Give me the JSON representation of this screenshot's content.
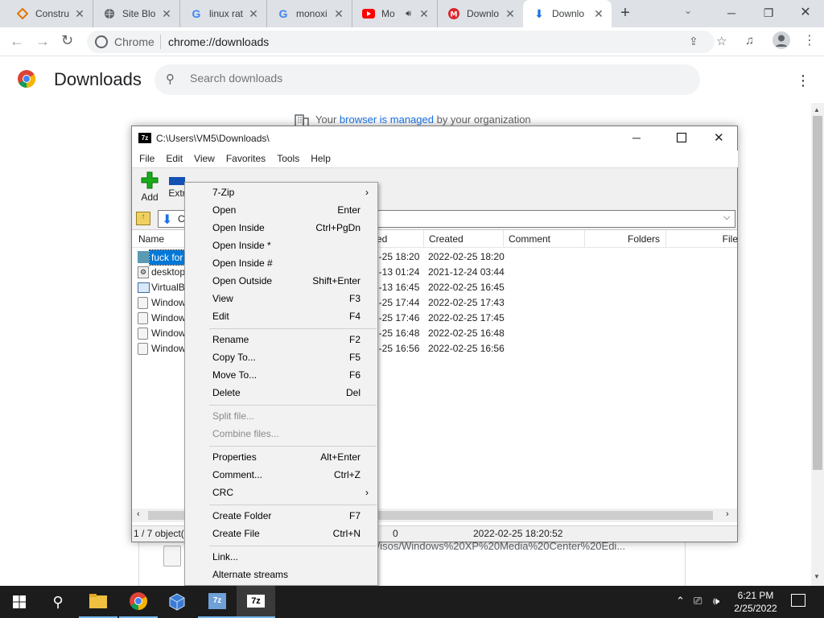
{
  "browser": {
    "tabs": [
      {
        "title": "Constru",
        "icon": "construct-icon"
      },
      {
        "title": "Site Blo",
        "icon": "globe-icon"
      },
      {
        "title": "linux rat",
        "icon": "google-icon"
      },
      {
        "title": "monoxi",
        "icon": "google-icon"
      },
      {
        "title": "Mo",
        "icon": "youtube-icon"
      },
      {
        "title": "Downlo",
        "icon": "mega-icon"
      },
      {
        "title": "Downlo",
        "icon": "download-icon"
      }
    ],
    "omnibox": {
      "site": "Chrome",
      "url": "chrome://downloads"
    }
  },
  "downloads_page": {
    "title": "Downloads",
    "search_placeholder": "Search downloads",
    "managed_prefix": "Your",
    "managed_link": "browser is managed",
    "managed_suffix": "by your organization",
    "item_url_fragment": "t/isos/Windows%20XP%20Media%20Center%20Edi..."
  },
  "zip": {
    "title": "C:\\Users\\VM5\\Downloads\\",
    "menu": [
      "File",
      "Edit",
      "View",
      "Favorites",
      "Tools",
      "Help"
    ],
    "toolbar": {
      "add": "Add",
      "extract": "Extr"
    },
    "address_prefix": "C",
    "columns": {
      "name": "Name",
      "modified": "ed",
      "created": "Created",
      "comment": "Comment",
      "folders": "Folders",
      "files": "File"
    },
    "rows": [
      {
        "name": "fuck for",
        "modified": "2-25 18:20",
        "created": "2022-02-25 18:20",
        "selected": true
      },
      {
        "name": "desktop",
        "modified": "2-13 01:24",
        "created": "2021-12-24 03:44"
      },
      {
        "name": "VirtualB",
        "modified": "2-13 16:45",
        "created": "2022-02-25 16:45"
      },
      {
        "name": "Window",
        "modified": "2-25 17:44",
        "created": "2022-02-25 17:43"
      },
      {
        "name": "Window",
        "modified": "2-25 17:46",
        "created": "2022-02-25 17:45"
      },
      {
        "name": "Window",
        "modified": "2-25 16:48",
        "created": "2022-02-25 16:48"
      },
      {
        "name": "Window",
        "modified": "2-25 16:56",
        "created": "2022-02-25 16:56"
      }
    ],
    "status": {
      "objects": "1 / 7 object(",
      "size": "0",
      "date": "2022-02-25 18:20:52"
    }
  },
  "context_menu": {
    "items": [
      {
        "label": "7-Zip",
        "key": "",
        "submenu": true
      },
      {
        "label": "Open",
        "key": "Enter"
      },
      {
        "label": "Open Inside",
        "key": "Ctrl+PgDn"
      },
      {
        "label": "Open Inside *",
        "key": ""
      },
      {
        "label": "Open Inside #",
        "key": ""
      },
      {
        "label": "Open Outside",
        "key": "Shift+Enter"
      },
      {
        "label": "View",
        "key": "F3"
      },
      {
        "label": "Edit",
        "key": "F4"
      },
      {
        "label": "Rename",
        "key": "F2"
      },
      {
        "label": "Copy To...",
        "key": "F5"
      },
      {
        "label": "Move To...",
        "key": "F6"
      },
      {
        "label": "Delete",
        "key": "Del"
      },
      {
        "label": "Split file...",
        "key": "",
        "disabled": true
      },
      {
        "label": "Combine files...",
        "key": "",
        "disabled": true
      },
      {
        "label": "Properties",
        "key": "Alt+Enter"
      },
      {
        "label": "Comment...",
        "key": "Ctrl+Z"
      },
      {
        "label": "CRC",
        "key": "",
        "submenu": true
      },
      {
        "label": "Create Folder",
        "key": "F7"
      },
      {
        "label": "Create File",
        "key": "Ctrl+N"
      },
      {
        "label": "Link...",
        "key": ""
      },
      {
        "label": "Alternate streams",
        "key": ""
      }
    ]
  },
  "taskbar": {
    "time": "6:21 PM",
    "date": "2/25/2022"
  },
  "colors": {
    "chrome_tabstrip": "#dee1e6",
    "link_blue": "#1a73e8",
    "selection": "#0078d7",
    "taskbar": "#1c1c1c"
  }
}
